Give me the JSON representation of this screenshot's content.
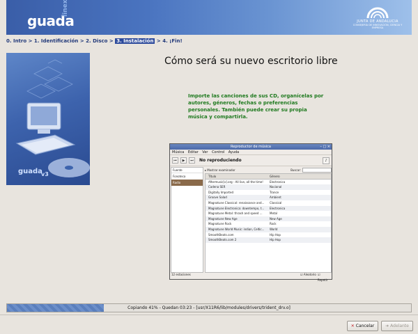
{
  "banner": {
    "logo": "guada",
    "logo_sub": "linex",
    "org_line1": "JUNTA DE ANDALUCIA",
    "org_line2": "CONSEJERÍA DE INNOVACIÓN, CIENCIA Y EMPRESA"
  },
  "breadcrumb": {
    "step0": "0. Intro",
    "step1": "1. Identificación",
    "step2": "2. Disco",
    "step3": "3. Instalación",
    "step4": "4. ¡Fin!",
    "sep": ">"
  },
  "side_image": {
    "brand": "guada",
    "version": "v3"
  },
  "main": {
    "title": "Cómo será su nuevo escritorio libre",
    "description": "Importe las canciones de sus CD, organícelas por autores, géneros, fechas o preferencias personales. También puede crear su propia música y compartirla."
  },
  "player": {
    "window_title": "Reproductor de música",
    "menu": [
      "Música",
      "Editar",
      "Ver",
      "Control",
      "Ayuda"
    ],
    "now_playing": "No reproduciendo",
    "show_browser": "Mostrar examinador",
    "search_label": "Buscar:",
    "source_header": "Fuente",
    "sources": [
      "Fonoteca",
      "Radio"
    ],
    "col_title": "Título",
    "col_genre": "Género",
    "stations": [
      [
        "Aftermusic[x].org - All live, all the time!",
        "Electronica"
      ],
      [
        "Cadena SER",
        "Nacional"
      ],
      [
        "Digitally Imported",
        "Trance"
      ],
      [
        "Groove Salad",
        "Ambient"
      ],
      [
        "Magnatune Classical: renaissance and...",
        "Classical"
      ],
      [
        "Magnatune Electronica: downtempo, t...",
        "Electronica"
      ],
      [
        "Magnatune Metal: thrash and speed ...",
        "Metal"
      ],
      [
        "Magnatune New Age",
        "New Age"
      ],
      [
        "Magnatune Rock",
        "Rock"
      ],
      [
        "Magnatune World Music: indian, Celtic...",
        "World"
      ],
      [
        "SmoothBeats.com",
        "Hip Hop"
      ],
      [
        "SmoothBeats.com 2",
        "Hip Hop"
      ]
    ],
    "status": "12 estaciones",
    "random": "Aleatorio",
    "repeat": "Repetir"
  },
  "progress": {
    "text": "Copiando 41% - Quedan 03:23 - [usr/X11R6/lib/modules/drivers/trident_drv.o]",
    "value": 0.41
  },
  "buttons": {
    "cancel": "Cancelar",
    "next": "Adelante"
  },
  "colors": {
    "breadcrumb": "#233a7a",
    "description": "#1f7a1f",
    "banner": "#3a5ea8"
  }
}
